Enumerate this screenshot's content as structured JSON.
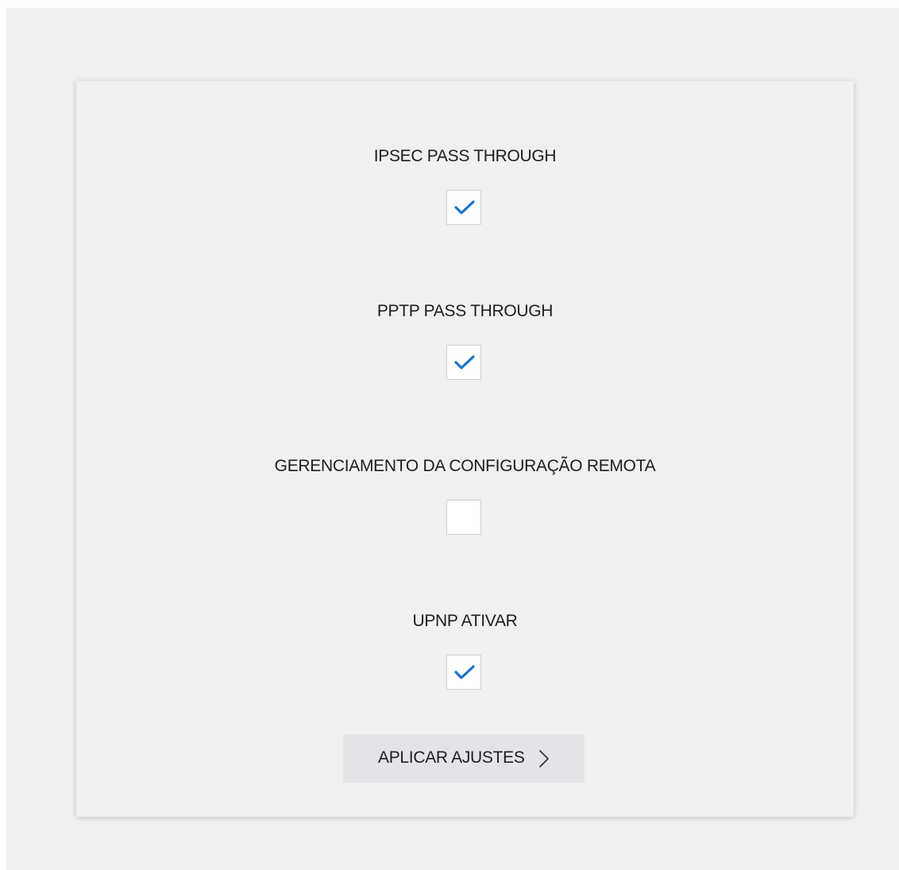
{
  "settings": [
    {
      "label": "IPSEC PASS THROUGH",
      "checked": true
    },
    {
      "label": "PPTP PASS THROUGH",
      "checked": true
    },
    {
      "label": "GERENCIAMENTO DA CONFIGURAÇÃO REMOTA",
      "checked": false
    },
    {
      "label": "UPNP ATIVAR",
      "checked": true
    }
  ],
  "apply_button": {
    "label": "APLICAR AJUSTES",
    "icon": "chevron-right-icon"
  },
  "colors": {
    "background": "#f0f0f0",
    "check_accent": "#1a73c8",
    "button_background": "#e2e4ea",
    "text": "#1e1e1e"
  }
}
